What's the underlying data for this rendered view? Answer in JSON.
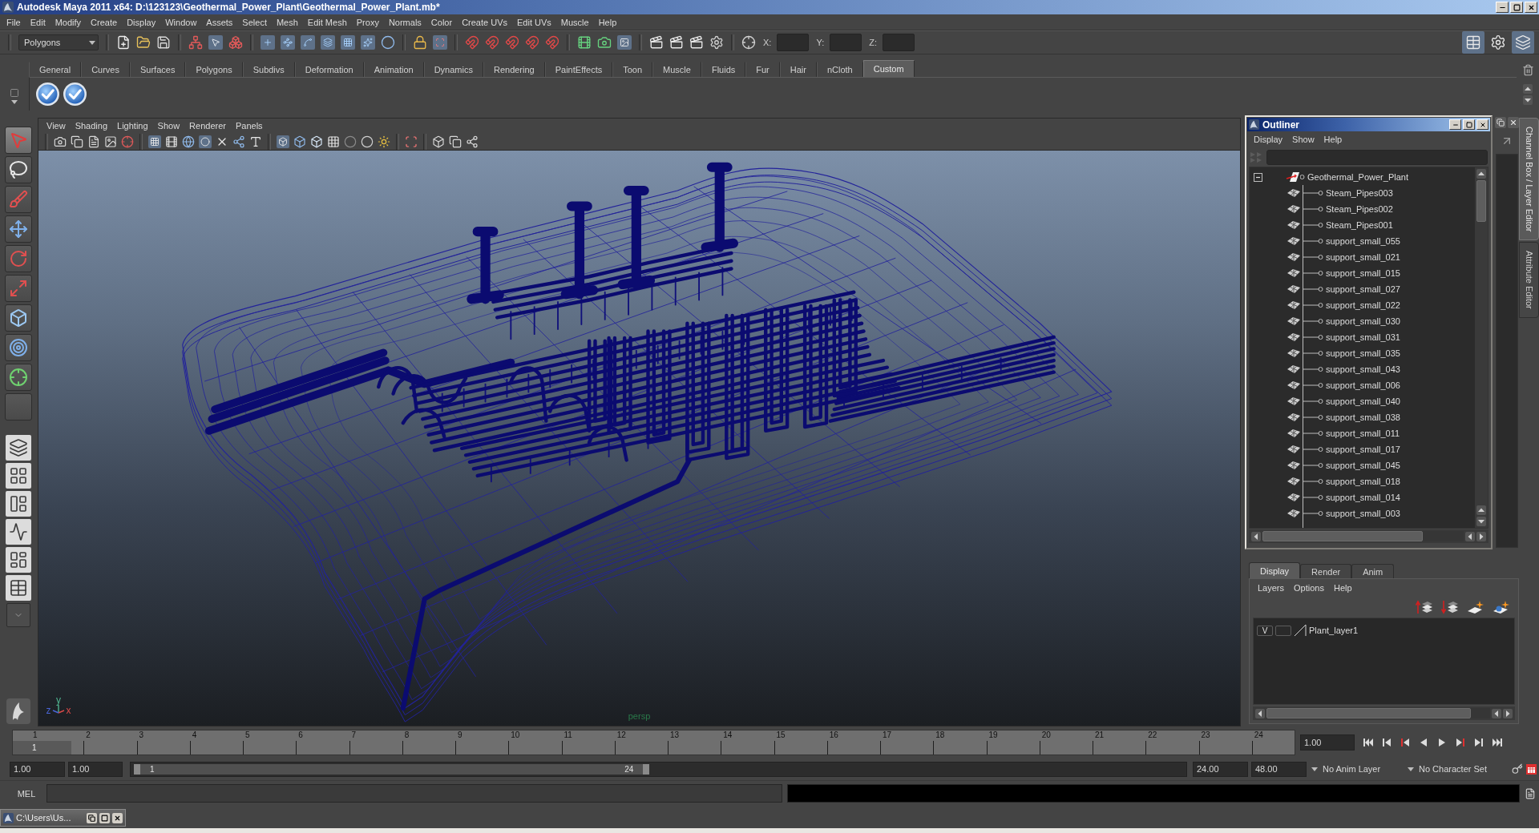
{
  "window": {
    "title": "Autodesk Maya 2011 x64: D:\\123123\\Geothermal_Power_Plant\\Geothermal_Power_Plant.mb*"
  },
  "menu_bar": [
    "File",
    "Edit",
    "Modify",
    "Create",
    "Display",
    "Window",
    "Assets",
    "Select",
    "Mesh",
    "Edit Mesh",
    "Proxy",
    "Normals",
    "Color",
    "Create UVs",
    "Edit UVs",
    "Muscle",
    "Help"
  ],
  "status_line": {
    "menu_set": "Polygons",
    "coordinate_labels": [
      "X:",
      "Y:",
      "Z:"
    ]
  },
  "shelf": {
    "tabs": [
      {
        "label": "General",
        "selected": false
      },
      {
        "label": "Curves",
        "selected": false
      },
      {
        "label": "Surfaces",
        "selected": false
      },
      {
        "label": "Polygons",
        "selected": false
      },
      {
        "label": "Subdivs",
        "selected": false
      },
      {
        "label": "Deformation",
        "selected": false
      },
      {
        "label": "Animation",
        "selected": false
      },
      {
        "label": "Dynamics",
        "selected": false
      },
      {
        "label": "Rendering",
        "selected": false
      },
      {
        "label": "PaintEffects",
        "selected": false
      },
      {
        "label": "Toon",
        "selected": false
      },
      {
        "label": "Muscle",
        "selected": false
      },
      {
        "label": "Fluids",
        "selected": false
      },
      {
        "label": "Fur",
        "selected": false
      },
      {
        "label": "Hair",
        "selected": false
      },
      {
        "label": "nCloth",
        "selected": false
      },
      {
        "label": "Custom",
        "selected": true
      }
    ]
  },
  "viewport": {
    "menu": [
      "View",
      "Shading",
      "Lighting",
      "Show",
      "Renderer",
      "Panels"
    ],
    "camera": "persp",
    "axis_labels": [
      "y",
      "z",
      "x"
    ]
  },
  "outliner": {
    "title": "Outliner",
    "menu": [
      "Display",
      "Show",
      "Help"
    ],
    "tree": [
      {
        "label": "Geothermal_Power_Plant",
        "expanded": true,
        "children": [
          {
            "label": "Steam_Pipes003"
          },
          {
            "label": "Steam_Pipes002"
          },
          {
            "label": "Steam_Pipes001"
          },
          {
            "label": "support_small_055"
          },
          {
            "label": "support_small_021"
          },
          {
            "label": "support_small_015"
          },
          {
            "label": "support_small_027"
          },
          {
            "label": "support_small_022"
          },
          {
            "label": "support_small_030"
          },
          {
            "label": "support_small_031"
          },
          {
            "label": "support_small_035"
          },
          {
            "label": "support_small_043"
          },
          {
            "label": "support_small_006"
          },
          {
            "label": "support_small_040"
          },
          {
            "label": "support_small_038"
          },
          {
            "label": "support_small_011"
          },
          {
            "label": "support_small_017"
          },
          {
            "label": "support_small_045"
          },
          {
            "label": "support_small_018"
          },
          {
            "label": "support_small_014"
          },
          {
            "label": "support_small_003"
          }
        ]
      }
    ]
  },
  "side_tabs": [
    {
      "label": "Channel Box / Layer Editor",
      "selected": true
    },
    {
      "label": "Attribute Editor",
      "selected": false
    }
  ],
  "layer_editor": {
    "tabs": [
      {
        "label": "Display",
        "selected": true
      },
      {
        "label": "Render",
        "selected": false
      },
      {
        "label": "Anim",
        "selected": false
      }
    ],
    "menu": [
      "Layers",
      "Options",
      "Help"
    ],
    "layers": [
      {
        "visibility": "V",
        "templated": false,
        "name": "Plant_layer1"
      }
    ]
  },
  "timeline": {
    "frames": [
      "1",
      "2",
      "3",
      "4",
      "5",
      "6",
      "7",
      "8",
      "9",
      "10",
      "11",
      "12",
      "13",
      "14",
      "15",
      "16",
      "17",
      "18",
      "19",
      "20",
      "21",
      "22",
      "23",
      "24"
    ],
    "level": 0,
    "current_frame": "1",
    "current_time": "1.00"
  },
  "range_slider": {
    "start_time": "1.00",
    "playback_start": "1.00",
    "range_start": "1",
    "range_end": "24",
    "level": 0.49,
    "playback_end": "24.00",
    "end_time": "48.00",
    "anim_layer": "No Anim Layer",
    "character_set": "No Character Set"
  },
  "command_line": {
    "language": "MEL"
  },
  "taskbar": {
    "minimized_window": "C:\\Users\\Us..."
  }
}
